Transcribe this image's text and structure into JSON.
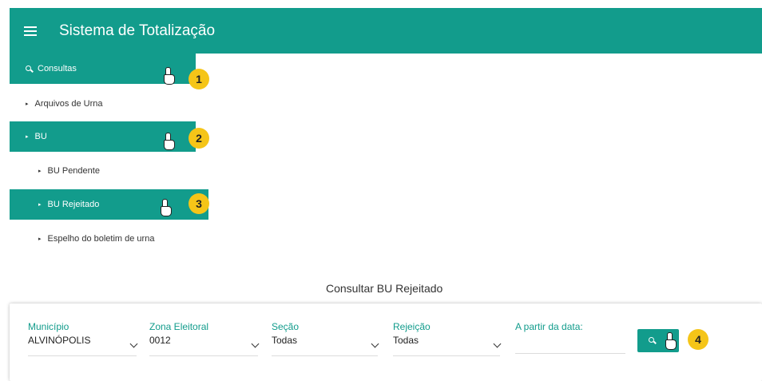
{
  "app": {
    "title": "Sistema de Totalização"
  },
  "menu": {
    "consultas": "Consultas",
    "arquivos": "Arquivos de Urna",
    "bu": "BU",
    "bu_pendente": "BU Pendente",
    "bu_rejeitado": "BU Rejeitado",
    "espelho": "Espelho do boletim de urna"
  },
  "steps": [
    "1",
    "2",
    "3",
    "4"
  ],
  "page": {
    "title": "Consultar BU Rejeitado"
  },
  "filters": {
    "municipio": {
      "label": "Município",
      "value": "ALVINÓPOLIS"
    },
    "zona": {
      "label": "Zona Eleitoral",
      "value": "0012"
    },
    "secao": {
      "label": "Seção",
      "value": "Todas"
    },
    "rejeicao": {
      "label": "Rejeição",
      "value": "Todas"
    },
    "data": {
      "label": "A partir da data:",
      "value": ""
    }
  },
  "colors": {
    "primary": "#129c8c",
    "badge": "#f5c518"
  },
  "icons": [
    "menu-icon",
    "search-icon",
    "pointer-hand-icon",
    "chevron-down-icon"
  ]
}
